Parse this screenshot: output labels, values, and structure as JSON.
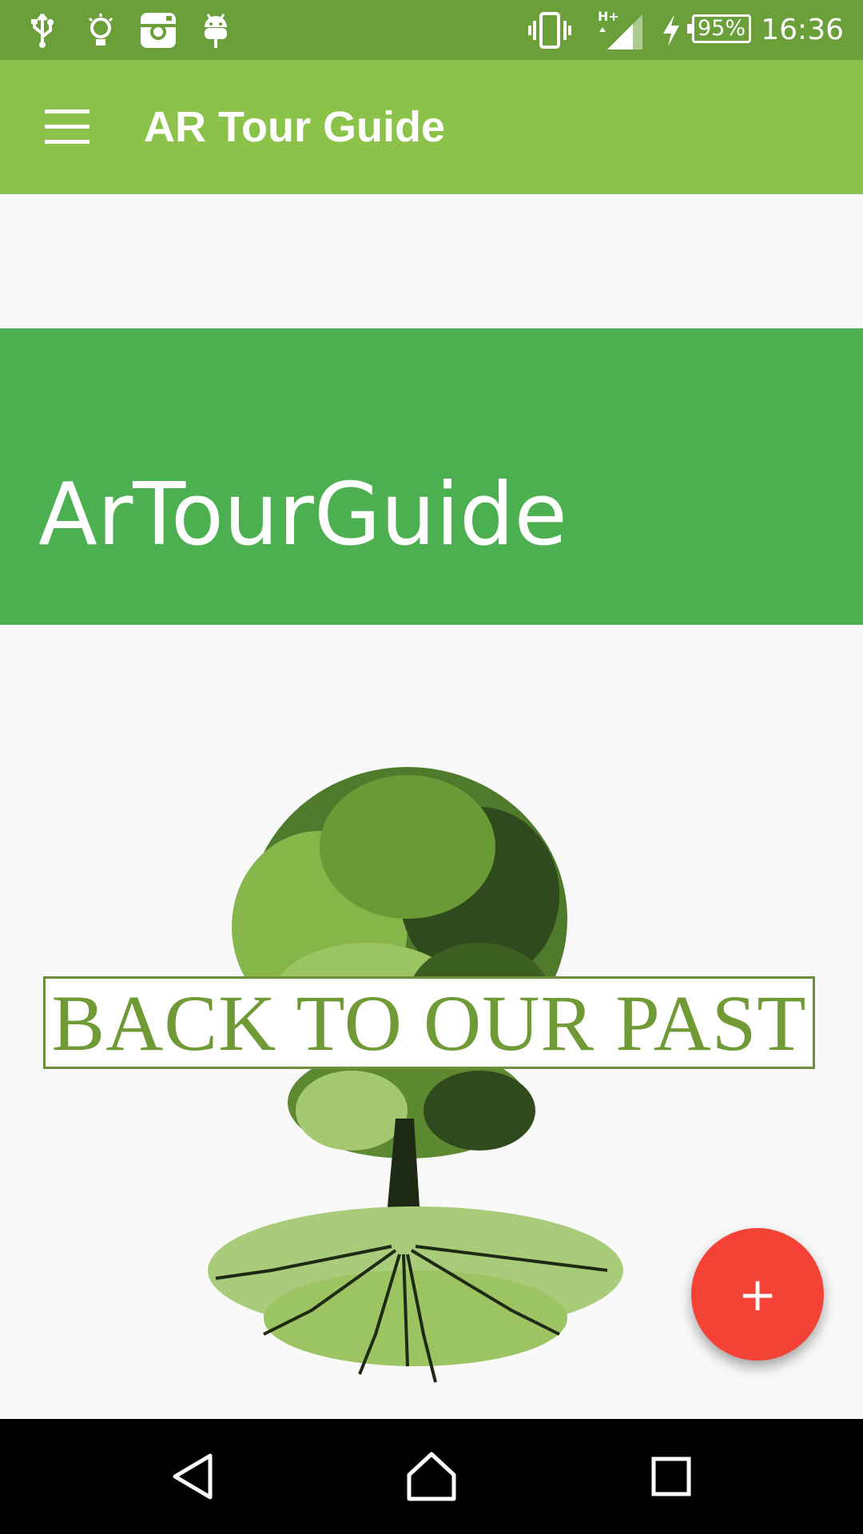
{
  "status_bar": {
    "time": "16:36",
    "battery_text": "95%",
    "network_label": "H+",
    "icons": [
      "usb-icon",
      "lightbulb-icon",
      "instagram-icon",
      "android-icon",
      "vibrate-icon",
      "signal-icon",
      "charging-icon",
      "battery-icon"
    ]
  },
  "app_bar": {
    "title": "AR Tour Guide",
    "menu_icon": "hamburger-menu-icon"
  },
  "hero": {
    "title": "ArTourGuide"
  },
  "logo": {
    "banner_text": "BACK TO OUR PAST",
    "image": "tree-with-roots-logo"
  },
  "fab": {
    "label": "+",
    "icon": "add-icon",
    "color": "#f44336"
  },
  "nav_bar": {
    "buttons": [
      "back-icon",
      "home-icon",
      "recents-icon"
    ]
  },
  "colors": {
    "status_bar": "#6a9f3a",
    "app_bar": "#8bc34a",
    "hero": "#4caf50",
    "background": "#f9f9f9"
  }
}
